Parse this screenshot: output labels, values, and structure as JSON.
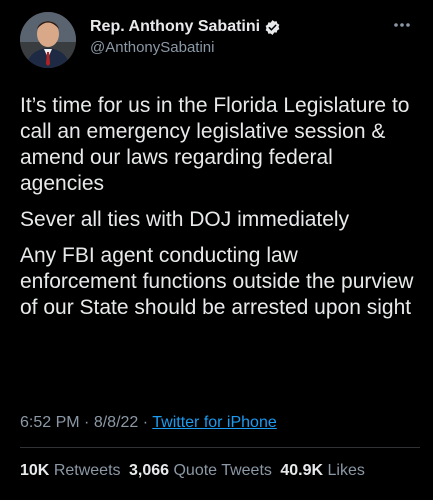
{
  "author": {
    "display_name": "Rep. Anthony Sabatini",
    "handle": "@AnthonySabatini",
    "verified_icon": "verified-badge-icon",
    "avatar_icon": "profile-photo"
  },
  "tweet": {
    "paragraphs": [
      "It’s time for us in the Florida Legislature to call an emergency legislative session & amend our laws regarding federal agencies",
      "Sever all ties with DOJ immediately",
      "Any FBI agent conducting law enforcement functions outside the purview of our State should be arrested upon sight"
    ],
    "time": "6:52 PM",
    "date": "8/8/22",
    "separator": "·",
    "source": "Twitter for iPhone"
  },
  "stats": {
    "retweets_count": "10K",
    "retweets_label": "Retweets",
    "quotes_count": "3,066",
    "quotes_label": "Quote Tweets",
    "likes_count": "40.9K",
    "likes_label": "Likes"
  },
  "colors": {
    "background": "#000000",
    "text": "#e7e9ea",
    "secondary_text": "#8b98a5",
    "link": "#1d9bf0",
    "divider": "#2f3336"
  }
}
